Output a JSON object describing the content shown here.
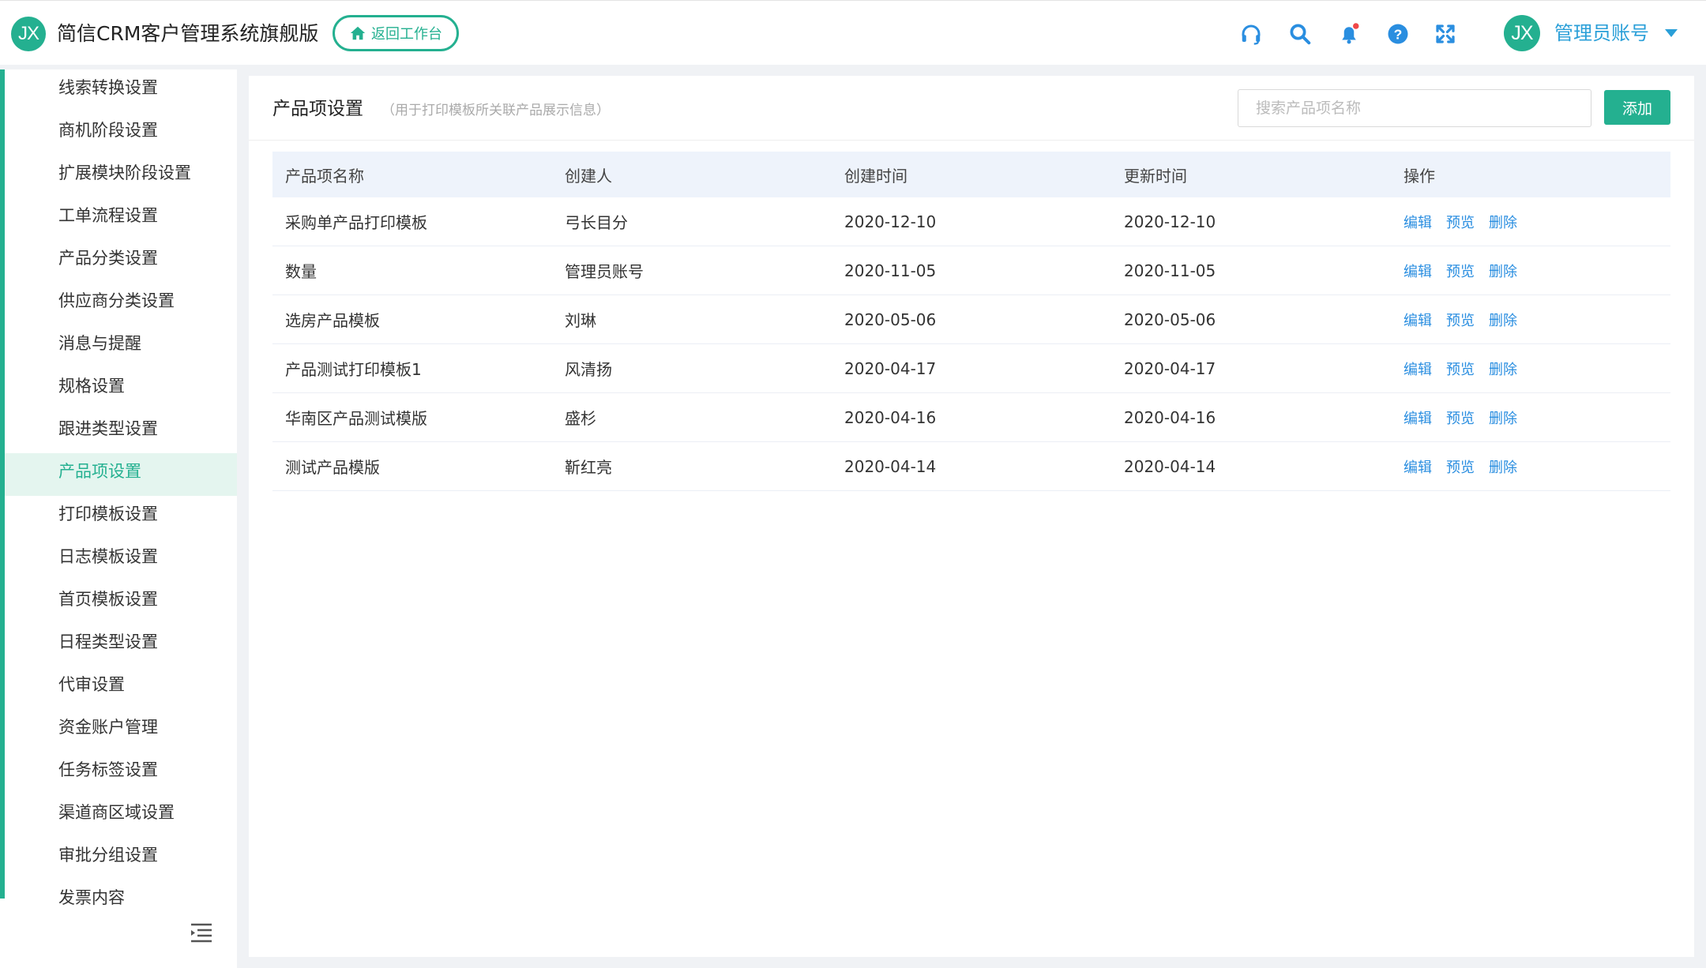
{
  "header": {
    "logo_text": "JX",
    "app_title": "简信CRM客户管理系统旗舰版",
    "back_label": "返回工作台",
    "icons": [
      "headset-icon",
      "search-icon",
      "bell-icon",
      "help-icon",
      "fullscreen-icon"
    ],
    "avatar_text": "JX",
    "user_name": "管理员账号",
    "accent_color": "#24b090",
    "link_color": "#2a9fd8"
  },
  "sidebar": {
    "items": [
      {
        "label": "线索转换设置"
      },
      {
        "label": "商机阶段设置"
      },
      {
        "label": "扩展模块阶段设置"
      },
      {
        "label": "工单流程设置"
      },
      {
        "label": "产品分类设置"
      },
      {
        "label": "供应商分类设置"
      },
      {
        "label": "消息与提醒"
      },
      {
        "label": "规格设置"
      },
      {
        "label": "跟进类型设置"
      },
      {
        "label": "产品项设置",
        "active": true
      },
      {
        "label": "打印模板设置"
      },
      {
        "label": "日志模板设置"
      },
      {
        "label": "首页模板设置"
      },
      {
        "label": "日程类型设置"
      },
      {
        "label": "代审设置"
      },
      {
        "label": "资金账户管理"
      },
      {
        "label": "任务标签设置"
      },
      {
        "label": "渠道商区域设置"
      },
      {
        "label": "审批分组设置"
      },
      {
        "label": "发票内容"
      }
    ]
  },
  "main": {
    "title": "产品项设置",
    "subtitle": "（用于打印模板所关联产品展示信息）",
    "search_placeholder": "搜索产品项名称",
    "add_label": "添加",
    "columns": [
      "产品项名称",
      "创建人",
      "创建时间",
      "更新时间",
      "操作"
    ],
    "actions": {
      "edit": "编辑",
      "preview": "预览",
      "delete": "删除"
    },
    "rows": [
      {
        "name": "采购单产品打印模板",
        "creator": "弓长目分",
        "created": "2020-12-10",
        "updated": "2020-12-10"
      },
      {
        "name": "数量",
        "creator": "管理员账号",
        "created": "2020-11-05",
        "updated": "2020-11-05"
      },
      {
        "name": "选房产品模板",
        "creator": "刘琳",
        "created": "2020-05-06",
        "updated": "2020-05-06"
      },
      {
        "name": "产品测试打印模板1",
        "creator": "风清扬",
        "created": "2020-04-17",
        "updated": "2020-04-17"
      },
      {
        "name": "华南区产品测试模版",
        "creator": "盛杉",
        "created": "2020-04-16",
        "updated": "2020-04-16"
      },
      {
        "name": "测试产品模版",
        "creator": "靳红亮",
        "created": "2020-04-14",
        "updated": "2020-04-14"
      }
    ]
  }
}
